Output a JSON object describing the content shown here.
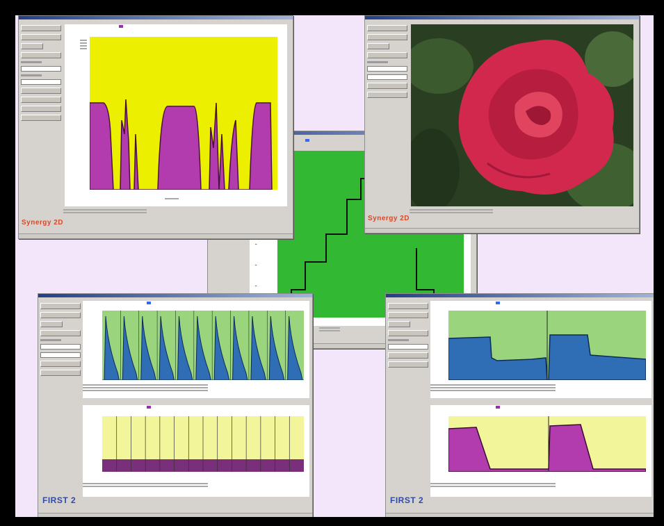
{
  "windows": {
    "window1": {
      "brand": "Synergy 2D"
    },
    "window2": {
      "brand": "Synergy 2D"
    },
    "window4": {
      "brand": "FIRST 2"
    },
    "window5": {
      "brand": "FIRST 2"
    }
  },
  "colors": {
    "yellow_plot": "#ecf000",
    "magenta_fill": "#b23cad",
    "green_plot": "#32b832",
    "light_green_plot": "#9ad57e",
    "blue_fill": "#2f6db5",
    "pale_yellow_plot": "#f2f59a",
    "rose": "#d3284d",
    "foliage": "#2a3f22"
  },
  "icons": [
    "rose-photo"
  ]
}
